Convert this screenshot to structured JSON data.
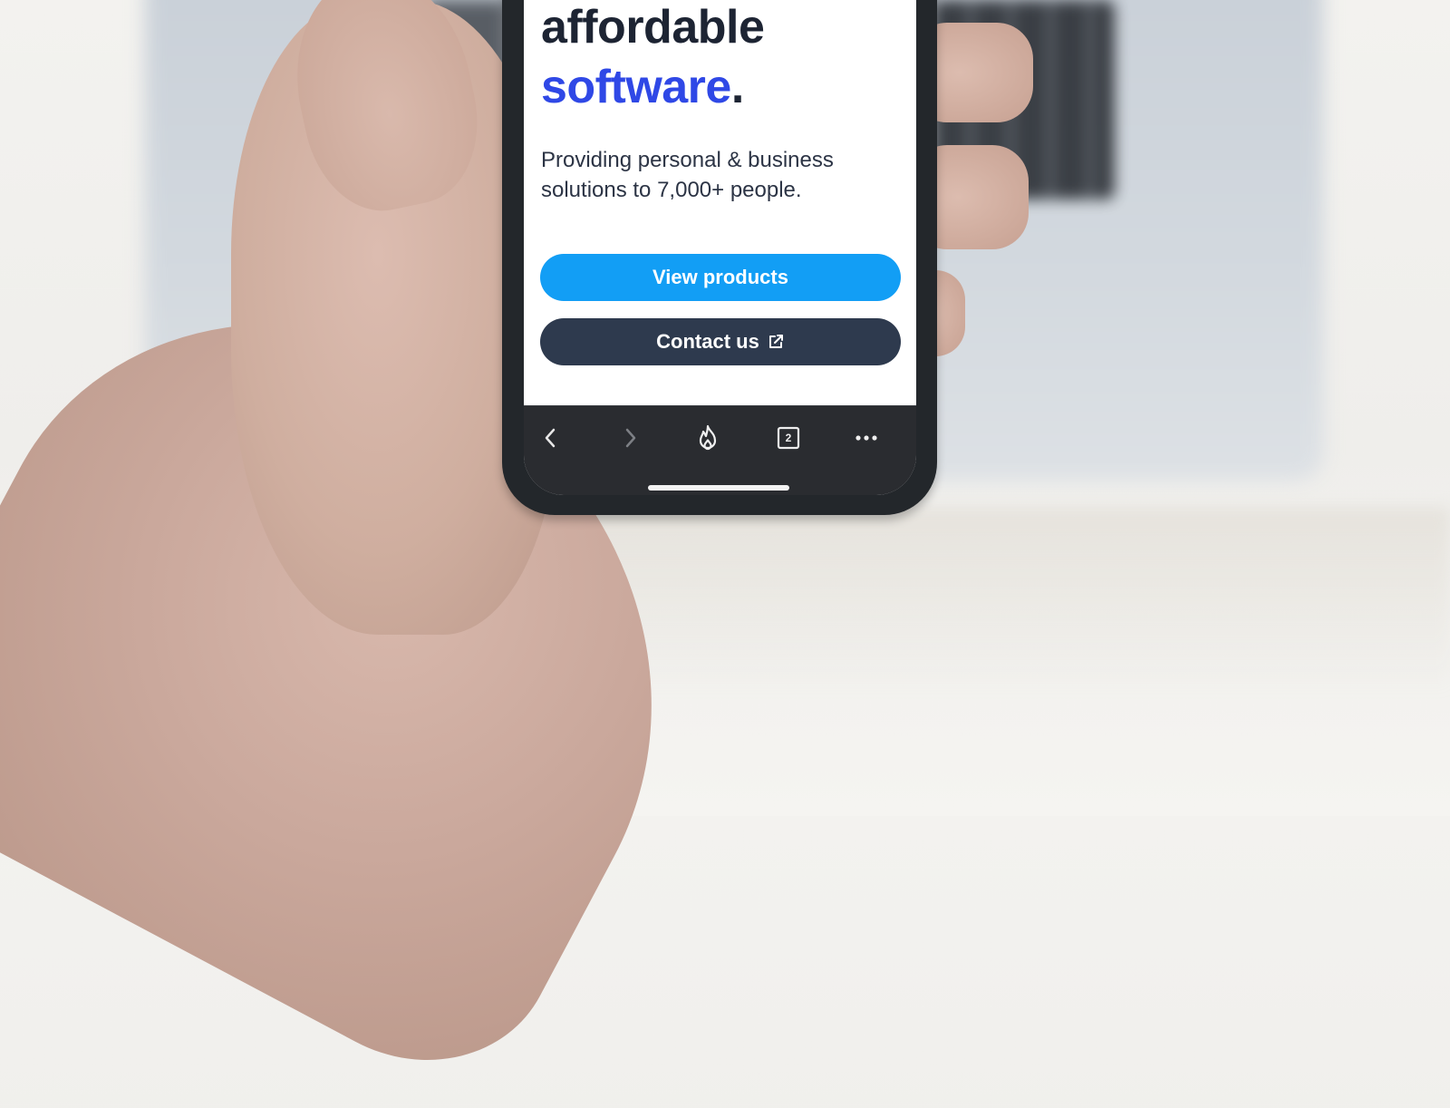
{
  "hero": {
    "line1": "affordable",
    "line2_accent": "software",
    "line2_period": ".",
    "subtitle": "Providing personal & business solutions to 7,000+ people."
  },
  "buttons": {
    "primary_label": "View products",
    "secondary_label": "Contact us"
  },
  "toolbar": {
    "tabs_count": "2",
    "icons": [
      "back-icon",
      "forward-icon",
      "flame-icon",
      "tabs-icon",
      "more-icon"
    ]
  },
  "colors": {
    "accent_text": "#2f48e6",
    "primary_button": "#129ef5",
    "secondary_button": "#2e3a4e",
    "toolbar": "#2a2c30"
  }
}
